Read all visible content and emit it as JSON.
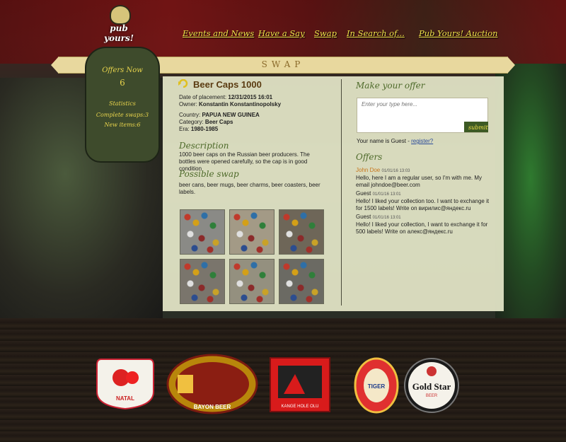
{
  "site": {
    "logo_text": "pub yours!"
  },
  "nav": [
    {
      "label": "Events and News"
    },
    {
      "label": "Have a Say"
    },
    {
      "label": "Swap"
    },
    {
      "label": "In Search of..."
    },
    {
      "label": "Pub Yours! Auction"
    }
  ],
  "ribbon": {
    "title": "SWAP"
  },
  "sidebar": {
    "offers_label": "Offers Now",
    "offers_count": "6",
    "stats_label": "Statistics",
    "complete_swaps": "Complete swaps:3",
    "new_items": "New items:6"
  },
  "item": {
    "title": "Beer Caps 1000",
    "date_label": "Date of placement:",
    "date_value": "12/31/2015 16:01",
    "owner_label": "Owner:",
    "owner_value": "Konstantin Konstantinopolsky",
    "country_label": "Country:",
    "country_value": "PAPUA NEW GUINEA",
    "category_label": "Category:",
    "category_value": "Beer Caps",
    "era_label": "Era:",
    "era_value": "1980-1985",
    "description_heading": "Description",
    "description_text": "1000 beer caps on the Russian beer producers. The bottles were opened carefully, so the cap is in good condition",
    "possible_swap_heading": "Possible swap",
    "possible_swap_text": "beer cans, beer mugs, beer charms, beer coasters, beer labels."
  },
  "offer_form": {
    "heading": "Make your offer",
    "placeholder": "Enter your type here...",
    "submit_label": "submit",
    "guest_text": "Your name is Guest -",
    "register_link": "register?"
  },
  "offers": {
    "heading": "Offers",
    "list": [
      {
        "author": "John Doe",
        "time": "01/01/16 13:03",
        "text": "Hello, here I am a regular user, so I'm with me. My email johndoe@beer.com"
      },
      {
        "author": "Guest",
        "time": "01/01/16 13:01",
        "text": "Hello! I liked your collection too. I want to exchange it for 1500 labels! Write on вирилис@яндекс.ru"
      },
      {
        "author": "Guest",
        "time": "01/01/16 13:01",
        "text": "Hello! I liked your collection, I want to exchange it for 500 labels! Write on алекс@яндекс.ru"
      }
    ]
  },
  "badges": [
    {
      "name": "natal",
      "text": "NATAL"
    },
    {
      "name": "bayon",
      "text": "BAYON BEER"
    },
    {
      "name": "kange",
      "text": "KANGE HOLE OLU"
    },
    {
      "name": "tiger",
      "text": "TIGER"
    },
    {
      "name": "goldstar",
      "text": "Gold Star",
      "sub": "BEER"
    }
  ]
}
